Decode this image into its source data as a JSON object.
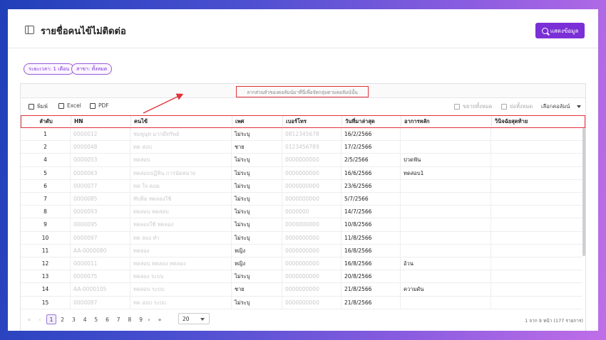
{
  "header": {
    "title": "รายชื่อคนไข้ไม่ติดต่อ",
    "show_button": "แสดงข้อมูล"
  },
  "filters": [
    {
      "label": "ระยะเวลา: 1 เดือน"
    },
    {
      "label": "สาขา: ทั้งหมด"
    }
  ],
  "grid": {
    "group_hint": "ลากส่วนหัวของคอลัมน์มาที่นี่เพื่อจัดกลุ่มตามคอลัมน์นั้น",
    "toolbar": {
      "print": "พิมพ์",
      "excel": "Excel",
      "pdf": "PDF",
      "expand_all": "ขยายทั้งหมด",
      "collapse_all": "ย่อทั้งหมด",
      "choose_columns": "เลือกคอลัมน์"
    },
    "columns": [
      "ลำดับ",
      "HN",
      "คนไข้",
      "เพศ",
      "เบอร์โทร",
      "วันที่มาล่าสุด",
      "อาการหลัก",
      "วินิจฉัยสุดท้าย"
    ],
    "rows": [
      {
        "no": "1",
        "hn": "0000012",
        "name": "ชมพูนุท มากมีทรัพย์",
        "sex": "ไม่ระบุ",
        "phone": "0812345678",
        "last_visit": "16/2/2566",
        "complaint": "",
        "diagnosis": ""
      },
      {
        "no": "2",
        "hn": "0000048",
        "name": "ทด สอบ",
        "sex": "ชาย",
        "phone": "0123456789",
        "last_visit": "17/2/2566",
        "complaint": "",
        "diagnosis": ""
      },
      {
        "no": "4",
        "hn": "0000053",
        "name": "ทดสอบ",
        "sex": "ไม่ระบุ",
        "phone": "0000000000",
        "last_visit": "2/5/2566",
        "complaint": "ปวดฟัน",
        "diagnosis": ""
      },
      {
        "no": "5",
        "hn": "0000063",
        "name": "ทดสอบปฏิทิน การนัดหมาย",
        "sex": "ไม่ระบุ",
        "phone": "0000000000",
        "last_visit": "16/6/2566",
        "complaint": "ทดสอบ1",
        "diagnosis": ""
      },
      {
        "no": "6",
        "hn": "0000077",
        "name": "ทด ใจ ดอม",
        "sex": "ไม่ระบุ",
        "phone": "0000000000",
        "last_visit": "23/6/2566",
        "complaint": "",
        "diagnosis": ""
      },
      {
        "no": "7",
        "hn": "0000085",
        "name": "ทับทิม ทดลองใช้",
        "sex": "ไม่ระบุ",
        "phone": "0000000000",
        "last_visit": "5/7/2566",
        "complaint": "",
        "diagnosis": ""
      },
      {
        "no": "8",
        "hn": "0000093",
        "name": "ทดสอบ ทดสอบ",
        "sex": "ไม่ระบุ",
        "phone": "0000000",
        "last_visit": "14/7/2566",
        "complaint": "",
        "diagnosis": ""
      },
      {
        "no": "9",
        "hn": "0000095",
        "name": "ทดลองใช้ ทดลอง",
        "sex": "ไม่ระบุ",
        "phone": "0000000000",
        "last_visit": "10/8/2566",
        "complaint": "",
        "diagnosis": ""
      },
      {
        "no": "10",
        "hn": "0000097",
        "name": "ทด ลอง ทำ",
        "sex": "ไม่ระบุ",
        "phone": "0000000000",
        "last_visit": "11/8/2566",
        "complaint": "",
        "diagnosis": ""
      },
      {
        "no": "11",
        "hn": "AA-0000080",
        "name": "ทดลอง",
        "sex": "หญิง",
        "phone": "0000000000",
        "last_visit": "16/8/2566",
        "complaint": "",
        "diagnosis": ""
      },
      {
        "no": "12",
        "hn": "0000011",
        "name": "ทดสอบ ทดลอง ทดลอง",
        "sex": "หญิง",
        "phone": "0000000000",
        "last_visit": "16/8/2566",
        "complaint": "อ้วน",
        "diagnosis": ""
      },
      {
        "no": "13",
        "hn": "0000075",
        "name": "ทดลอง ระบบ",
        "sex": "ไม่ระบุ",
        "phone": "0000000000",
        "last_visit": "20/8/2566",
        "complaint": "",
        "diagnosis": ""
      },
      {
        "no": "14",
        "hn": "AA-0000105",
        "name": "ทดสอบ ระบบ",
        "sex": "ชาย",
        "phone": "0000000000",
        "last_visit": "21/8/2566",
        "complaint": "ความดัน",
        "diagnosis": ""
      },
      {
        "no": "15",
        "hn": "0000087",
        "name": "ทด สอบ ระบบ",
        "sex": "ไม่ระบุ",
        "phone": "0000000000",
        "last_visit": "21/8/2566",
        "complaint": "",
        "diagnosis": ""
      }
    ]
  },
  "pager": {
    "first": "«",
    "prev": "‹",
    "next": "›",
    "last": "»",
    "pages": [
      "1",
      "2",
      "3",
      "4",
      "5",
      "6",
      "7",
      "8",
      "9"
    ],
    "active_page": "1",
    "page_size": "20",
    "info": "1 จาก 9 หน้า (177 รายการ)"
  },
  "colors": {
    "accent": "#7b2fd6",
    "annotation": "#e2333b"
  }
}
